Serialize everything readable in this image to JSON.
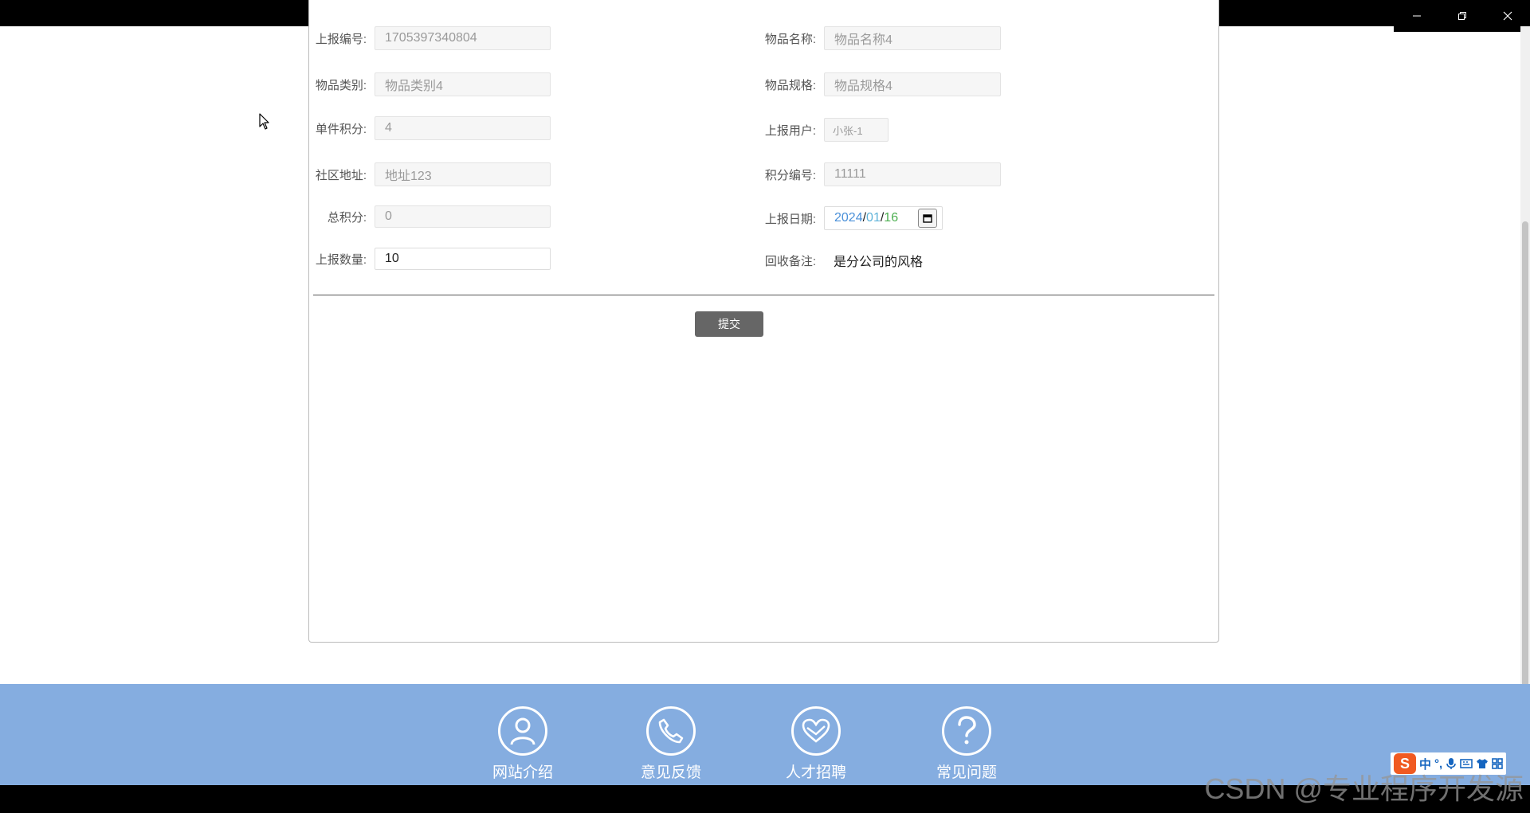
{
  "window": {
    "minimize_icon": "minimize-icon",
    "restore_icon": "restore-icon",
    "close_icon": "close-icon"
  },
  "form": {
    "fields_left": [
      {
        "label": "上报编号:",
        "value": "1705397340804"
      },
      {
        "label": "物品类别:",
        "value": "物品类别4"
      },
      {
        "label": "单件积分:",
        "value": "4"
      },
      {
        "label": "社区地址:",
        "value": "地址123"
      },
      {
        "label": "总积分:",
        "value": "0"
      },
      {
        "label": "上报数量:",
        "value": "10"
      }
    ],
    "fields_right": [
      {
        "label": "物品名称:",
        "value": "物品名称4"
      },
      {
        "label": "物品规格:",
        "value": "物品规格4"
      },
      {
        "label": "上报用户:",
        "value": "小张-1"
      },
      {
        "label": "积分编号:",
        "value": "11111"
      },
      {
        "label": "上报日期:",
        "year": "2024",
        "month": "01",
        "day": "16"
      },
      {
        "label": "回收备注:",
        "value": "是分公司的风格"
      }
    ],
    "submit_label": "提交"
  },
  "footer": {
    "items": [
      {
        "label": "网站介绍",
        "icon": "user-icon"
      },
      {
        "label": "意见反馈",
        "icon": "phone-icon"
      },
      {
        "label": "人才招聘",
        "icon": "heart-icon"
      },
      {
        "label": "常见问题",
        "icon": "question-icon"
      }
    ]
  },
  "ime": {
    "logo": "S",
    "lang": "中"
  },
  "watermark": "CSDN @专业程序开发源",
  "colors": {
    "footer_bg": "#85ade0",
    "submit_bg": "#666666"
  }
}
